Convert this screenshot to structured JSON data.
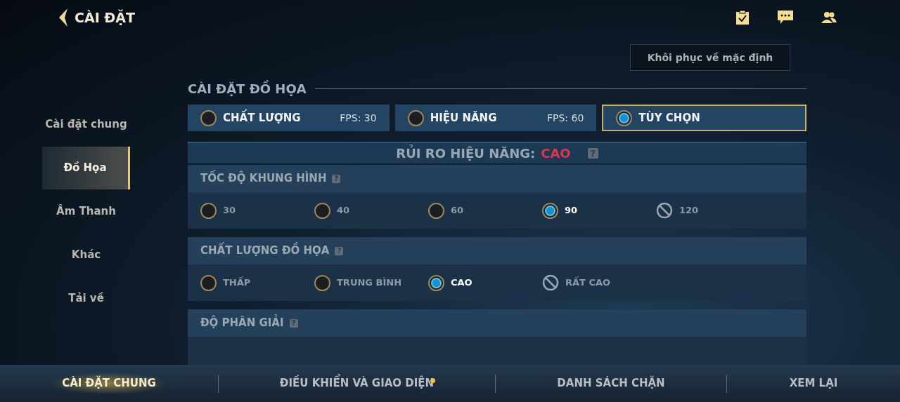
{
  "header": {
    "title": "CÀI ĐẶT"
  },
  "reset_button": "Khôi phục về mặc định",
  "sidebar": {
    "items": [
      {
        "label": "Cài đặt chung",
        "selected": false
      },
      {
        "label": "Đồ Họa",
        "selected": true
      },
      {
        "label": "Âm Thanh",
        "selected": false
      },
      {
        "label": "Khác",
        "selected": false
      },
      {
        "label": "Tải về",
        "selected": false
      }
    ]
  },
  "section_title": "CÀI ĐẶT ĐỒ HỌA",
  "presets": [
    {
      "label": "CHẤT LƯỢNG",
      "fps": "FPS: 30",
      "selected": false
    },
    {
      "label": "HIỆU NĂNG",
      "fps": "FPS: 60",
      "selected": false
    },
    {
      "label": "TÙY CHỌN",
      "selected": true
    }
  ],
  "risk": {
    "label": "RỦI RO HIỆU NĂNG:",
    "value": "CAO",
    "help": "?"
  },
  "settings": [
    {
      "title": "TỐC ĐỘ KHUNG HÌNH",
      "help": "?",
      "options": [
        {
          "label": "30",
          "selected": false,
          "disabled": false
        },
        {
          "label": "40",
          "selected": false,
          "disabled": false
        },
        {
          "label": "60",
          "selected": false,
          "disabled": false
        },
        {
          "label": "90",
          "selected": true,
          "disabled": false
        },
        {
          "label": "120",
          "selected": false,
          "disabled": true
        }
      ]
    },
    {
      "title": "CHẤT LƯỢNG ĐỒ HỌA",
      "help": "?",
      "options": [
        {
          "label": "THẤP",
          "selected": false,
          "disabled": false
        },
        {
          "label": "TRUNG BÌNH",
          "selected": false,
          "disabled": false
        },
        {
          "label": "CAO",
          "selected": true,
          "disabled": false
        },
        {
          "label": "RẤT CAO",
          "selected": false,
          "disabled": true
        }
      ]
    },
    {
      "title": "ĐỘ PHÂN GIẢI",
      "help": "?"
    }
  ],
  "bottom_tabs": [
    {
      "label": "CÀI ĐẶT CHUNG",
      "selected": true,
      "notify": false
    },
    {
      "label": "ĐIỀU KHIỂN VÀ GIAO DIỆN",
      "selected": false,
      "notify": true
    },
    {
      "label": "DANH SÁCH CHẶN",
      "selected": false,
      "notify": false
    },
    {
      "label": "XEM LẠI",
      "selected": false,
      "notify": false
    }
  ]
}
